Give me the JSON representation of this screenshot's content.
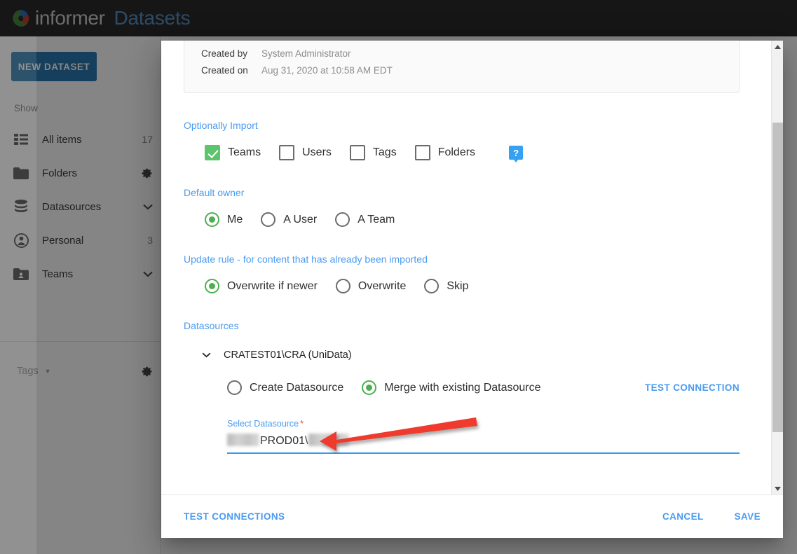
{
  "app": {
    "brand_primary": "informer",
    "brand_secondary": "Datasets",
    "logo_icon": "informer-logo-icon",
    "colors": {
      "topbar_bg": "#2b2b2b",
      "brand_primary_text": "#cfcfcf",
      "brand_secondary_text": "#5b90c4",
      "accent_blue": "#4a9bf0",
      "accent_green": "#4caf50",
      "checkbox_green": "#5cc46a",
      "field_underline": "#3d9ae8",
      "required_red": "#e64b3b",
      "annotation_red": "#ef3b2d",
      "new_dataset_button": "#2a7ab0"
    }
  },
  "sidebar": {
    "new_dataset_label": "NEW DATASET",
    "show_label": "Show",
    "items": [
      {
        "label": "All items",
        "icon": "list-icon",
        "count": "17",
        "trailing": "count"
      },
      {
        "label": "Folders",
        "icon": "folder-icon",
        "count": "",
        "trailing": "gear"
      },
      {
        "label": "Datasources",
        "icon": "database-icon",
        "count": "",
        "trailing": "chevron"
      },
      {
        "label": "Personal",
        "icon": "person-icon",
        "count": "3",
        "trailing": "count"
      },
      {
        "label": "Teams",
        "icon": "team-folder-icon",
        "count": "",
        "trailing": "chevron"
      }
    ],
    "tags_label": "Tags",
    "tags_gear_icon": "gear-icon"
  },
  "dialog": {
    "meta": {
      "created_by_label": "Created by",
      "created_by_value": "System Administrator",
      "created_on_label": "Created on",
      "created_on_value": "Aug 31, 2020 at 10:58 AM EDT"
    },
    "optionally_import": {
      "heading": "Optionally Import",
      "help_icon": "help-question-icon",
      "help_glyph": "?",
      "options": [
        {
          "label": "Teams",
          "checked": true
        },
        {
          "label": "Users",
          "checked": false
        },
        {
          "label": "Tags",
          "checked": false
        },
        {
          "label": "Folders",
          "checked": false
        }
      ]
    },
    "default_owner": {
      "heading": "Default owner",
      "options": [
        {
          "label": "Me",
          "selected": true
        },
        {
          "label": "A User",
          "selected": false
        },
        {
          "label": "A Team",
          "selected": false
        }
      ]
    },
    "update_rule": {
      "heading": "Update rule - for content that has already been imported",
      "options": [
        {
          "label": "Overwrite if newer",
          "selected": true
        },
        {
          "label": "Overwrite",
          "selected": false
        },
        {
          "label": "Skip",
          "selected": false
        }
      ]
    },
    "datasources": {
      "heading": "Datasources",
      "group_title": "CRATEST01\\CRA (UniData)",
      "group_chevron_icon": "chevron-down-icon",
      "mode_options": [
        {
          "label": "Create Datasource",
          "selected": false
        },
        {
          "label": "Merge with existing Datasource",
          "selected": true
        }
      ],
      "test_connection_label": "TEST CONNECTION",
      "select_datasource_label": "Select Datasource",
      "required_marker": "*",
      "select_datasource_value": "PROD01\\",
      "select_datasource_redacted_prefix": true,
      "select_datasource_redacted_suffix": true
    },
    "footer": {
      "test_connections_label": "TEST CONNECTIONS",
      "cancel_label": "CANCEL",
      "save_label": "SAVE"
    },
    "scrollbar": {
      "up_arrow_icon": "scroll-up-arrow-icon",
      "down_arrow_icon": "scroll-down-arrow-icon"
    }
  },
  "annotation": {
    "arrow_icon": "red-arrow-left-icon",
    "points_to": "Select Datasource value"
  }
}
